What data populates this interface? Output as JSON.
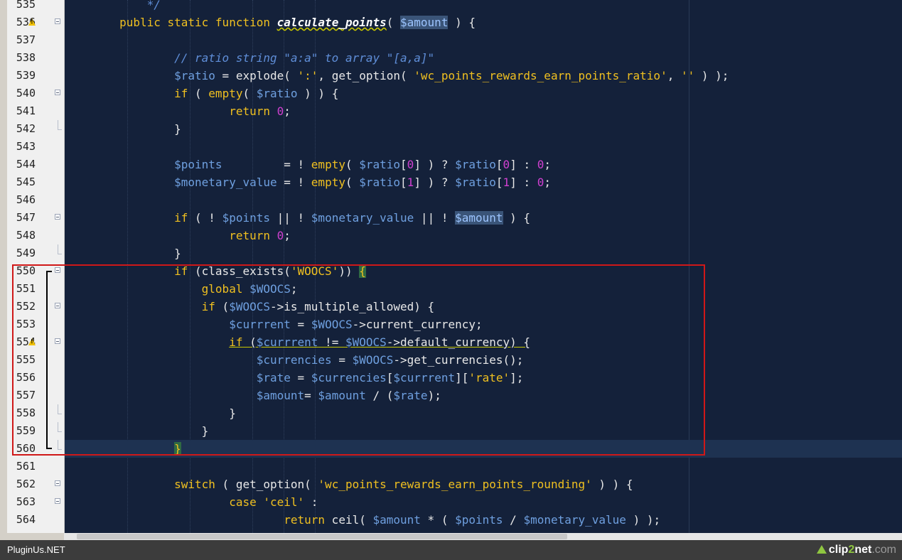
{
  "editor": {
    "lines": [
      {
        "n": "535",
        "html": "            <span class=\"cm\">*/</span>"
      },
      {
        "n": "536",
        "warn": true,
        "fold": "open",
        "html": "        <span class=\"kw\">public static function</span> <span class=\"fn-def\">calculate_points</span>( <span class=\"hl-var\">$amount</span> ) {"
      },
      {
        "n": "537",
        "html": ""
      },
      {
        "n": "538",
        "html": "                <span class=\"cm\">// ratio string \"a:a\" to array \"[a,a]\"</span>"
      },
      {
        "n": "539",
        "html": "                <span class=\"var\">$ratio</span> = explode( <span class=\"str\">':'</span>, get_option( <span class=\"str\">'wc_points_rewards_earn_points_ratio'</span>, <span class=\"str\">''</span> ) );"
      },
      {
        "n": "540",
        "fold": "open",
        "html": "                <span class=\"kw\">if</span> ( <span class=\"kw\">empty</span>( <span class=\"var\">$ratio</span> ) ) {"
      },
      {
        "n": "541",
        "html": "                        <span class=\"kw\">return</span> <span class=\"num\">0</span>;"
      },
      {
        "n": "542",
        "fold": "end",
        "html": "                }"
      },
      {
        "n": "543",
        "html": ""
      },
      {
        "n": "544",
        "html": "                <span class=\"var\">$points</span>         = ! <span class=\"kw\">empty</span>( <span class=\"var\">$ratio</span>[<span class=\"num\">0</span>] ) ? <span class=\"var\">$ratio</span>[<span class=\"num\">0</span>] : <span class=\"num\">0</span>;"
      },
      {
        "n": "545",
        "html": "                <span class=\"var\">$monetary_value</span> = ! <span class=\"kw\">empty</span>( <span class=\"var\">$ratio</span>[<span class=\"num\">1</span>] ) ? <span class=\"var\">$ratio</span>[<span class=\"num\">1</span>] : <span class=\"num\">0</span>;"
      },
      {
        "n": "546",
        "html": ""
      },
      {
        "n": "547",
        "fold": "open",
        "html": "                <span class=\"kw\">if</span> ( ! <span class=\"var\">$points</span> || ! <span class=\"var\">$monetary_value</span> || ! <span class=\"hl-var\">$amount</span> ) {"
      },
      {
        "n": "548",
        "html": "                        <span class=\"kw\">return</span> <span class=\"num\">0</span>;"
      },
      {
        "n": "549",
        "fold": "end",
        "html": "                }"
      },
      {
        "n": "550",
        "fold": "open",
        "bracket": "start",
        "html": "                <span class=\"kw\">if</span> (class_exists(<span class=\"str\">'WOOCS'</span>)) <span class=\"brace-match\">{</span>"
      },
      {
        "n": "551",
        "bracket": "mid",
        "html": "                    <span class=\"kw\">global</span> <span class=\"var\">$WOOCS</span>;"
      },
      {
        "n": "552",
        "fold": "open",
        "bracket": "mid",
        "html": "                    <span class=\"kw\">if</span> (<span class=\"var\">$WOOCS</span>->is_multiple_allowed) {"
      },
      {
        "n": "553",
        "bracket": "mid",
        "html": "                        <span class=\"var\">$currrent</span> = <span class=\"var\">$WOOCS</span>->current_currency;"
      },
      {
        "n": "554",
        "warn": true,
        "fold": "open",
        "bracket": "mid",
        "html": "                        <span class=\"warn-underline\"><span class=\"kw\">if</span> (<span class=\"var\">$currrent</span> != <span class=\"var\">$WOOCS</span>->default_currency) {</span>"
      },
      {
        "n": "555",
        "bracket": "mid",
        "html": "                            <span class=\"var\">$currencies</span> = <span class=\"var\">$WOOCS</span>->get_currencies();"
      },
      {
        "n": "556",
        "bracket": "mid",
        "html": "                            <span class=\"var\">$rate</span> = <span class=\"var\">$currencies</span>[<span class=\"var\">$currrent</span>][<span class=\"str\">'rate'</span>];"
      },
      {
        "n": "557",
        "bracket": "mid",
        "html": "                            <span class=\"var\">$amount</span>= <span class=\"var\">$amount</span> / (<span class=\"var\">$rate</span>);"
      },
      {
        "n": "558",
        "fold": "end",
        "bracket": "mid",
        "html": "                        }"
      },
      {
        "n": "559",
        "fold": "end",
        "bracket": "mid",
        "html": "                    }"
      },
      {
        "n": "560",
        "fold": "end",
        "bracket": "end",
        "current": true,
        "html": "                <span class=\"brace-match\">}</span>"
      },
      {
        "n": "561",
        "html": ""
      },
      {
        "n": "562",
        "fold": "open",
        "html": "                <span class=\"kw\">switch</span> ( get_option( <span class=\"str\">'wc_points_rewards_earn_points_rounding'</span> ) ) {"
      },
      {
        "n": "563",
        "fold": "open",
        "html": "                        <span class=\"kw\">case</span> <span class=\"str\">'ceil'</span> :"
      },
      {
        "n": "564",
        "html": "                                <span class=\"kw\">return</span> ceil( <span class=\"var\">$amount</span> * ( <span class=\"var\">$points</span> / <span class=\"var\">$monetary_value</span> ) );"
      }
    ]
  },
  "footer": {
    "left_text": "PluginUs.NET",
    "brand_a": "clip",
    "brand_b": "2",
    "brand_c": "net",
    "brand_d": ".com"
  },
  "colors": {
    "background": "#14213a",
    "keyword": "#f0c020",
    "variable": "#6fa0e0",
    "number": "#d040d0",
    "comment": "#5f8ed8",
    "selection_box": "#d01818"
  },
  "icons": {
    "warning": "warning-triangle-icon",
    "fold": "fold-collapse-icon",
    "footer_logo": "clip2net-arrow-icon"
  }
}
